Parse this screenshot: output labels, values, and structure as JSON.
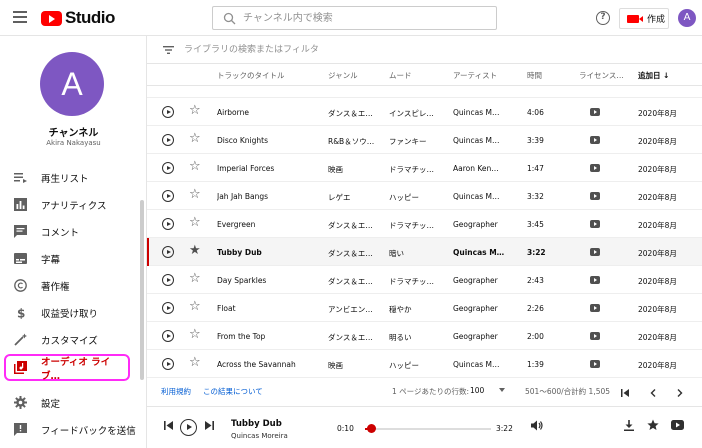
{
  "header": {
    "logo_text": "Studio",
    "search_placeholder": "チャンネル内で検索",
    "help_label": "?",
    "create_label": "作成",
    "avatar_letter": "A"
  },
  "sidebar": {
    "avatar_letter": "A",
    "channel_name": "チャンネル",
    "channel_handle": "Akira Nakayasu",
    "items": [
      {
        "label": "再生リスト",
        "icon": "playlist-icon"
      },
      {
        "label": "アナリティクス",
        "icon": "analytics-icon"
      },
      {
        "label": "コメント",
        "icon": "comment-icon"
      },
      {
        "label": "字幕",
        "icon": "subtitles-icon"
      },
      {
        "label": "著作権",
        "icon": "copyright-icon"
      },
      {
        "label": "収益受け取り",
        "icon": "dollar-icon"
      },
      {
        "label": "カスタマイズ",
        "icon": "magic-wand-icon"
      },
      {
        "label": "オーディオ ライブ…",
        "icon": "audio-library-icon"
      },
      {
        "label": "設定",
        "icon": "gear-icon"
      },
      {
        "label": "フィードバックを送信",
        "icon": "feedback-icon"
      }
    ],
    "active_index": 7
  },
  "library": {
    "filter_placeholder": "ライブラリの検索またはフィルタ",
    "columns": {
      "title": "トラックのタイトル",
      "genre": "ジャンル",
      "mood": "ムード",
      "artist": "アーティスト",
      "duration": "時間",
      "license": "ライセンス…",
      "added": "追加日"
    },
    "sort_arrow": "↓",
    "rows": [
      {
        "title": "Airborne",
        "genre": "ダンス＆エ…",
        "mood": "インスピレ…",
        "artist": "Quincas M…",
        "duration": "4:06",
        "added": "2020年8月",
        "starred": false
      },
      {
        "title": "Disco Knights",
        "genre": "R&B＆ソウ…",
        "mood": "ファンキー",
        "artist": "Quincas M…",
        "duration": "3:39",
        "added": "2020年8月",
        "starred": false
      },
      {
        "title": "Imperial Forces",
        "genre": "映画",
        "mood": "ドラマチッ…",
        "artist": "Aaron Ken…",
        "duration": "1:47",
        "added": "2020年8月",
        "starred": false
      },
      {
        "title": "Jah Jah Bangs",
        "genre": "レゲエ",
        "mood": "ハッピー",
        "artist": "Quincas M…",
        "duration": "3:32",
        "added": "2020年8月",
        "starred": false
      },
      {
        "title": "Evergreen",
        "genre": "ダンス＆エ…",
        "mood": "ドラマチッ…",
        "artist": "Geographer",
        "duration": "3:45",
        "added": "2020年8月",
        "starred": false
      },
      {
        "title": "Tubby Dub",
        "genre": "ダンス＆エ…",
        "mood": "暗い",
        "artist": "Quincas M…",
        "duration": "3:22",
        "added": "2020年8月",
        "starred": true
      },
      {
        "title": "Day Sparkles",
        "genre": "ダンス＆エ…",
        "mood": "ドラマチッ…",
        "artist": "Geographer",
        "duration": "2:43",
        "added": "2020年8月",
        "starred": false
      },
      {
        "title": "Float",
        "genre": "アンビエン…",
        "mood": "穏やか",
        "artist": "Geographer",
        "duration": "2:26",
        "added": "2020年8月",
        "starred": false
      },
      {
        "title": "From the Top",
        "genre": "ダンス＆エ…",
        "mood": "明るい",
        "artist": "Geographer",
        "duration": "2:00",
        "added": "2020年8月",
        "starred": false
      },
      {
        "title": "Across the Savannah",
        "genre": "映画",
        "mood": "ハッピー",
        "artist": "Quincas M…",
        "duration": "1:39",
        "added": "2020年8月",
        "starred": false
      }
    ],
    "current_index": 5,
    "footer": {
      "terms": "利用規約",
      "about": "この結果について",
      "rows_per_page_label": "1 ページあたりの行数:",
      "rows_per_page": "100",
      "range": "501〜600/合計約 1,505"
    }
  },
  "player": {
    "title": "Tubby Dub",
    "artist": "Quincas Moreira",
    "elapsed": "0:10",
    "total": "3:22",
    "progress": 0.05
  }
}
